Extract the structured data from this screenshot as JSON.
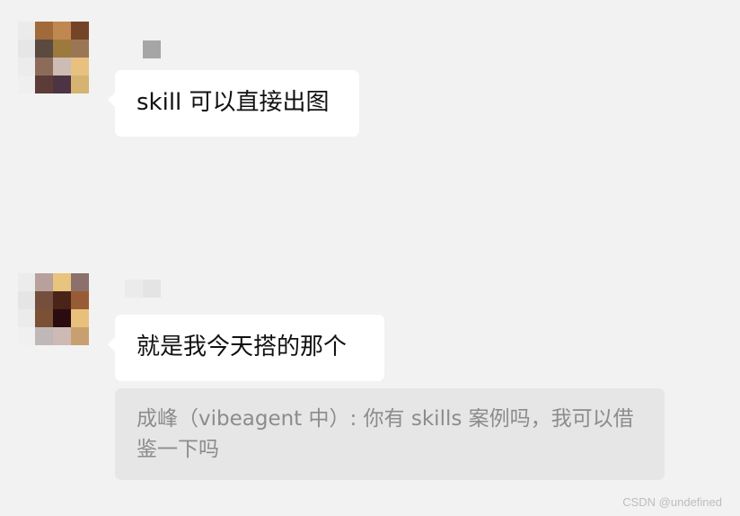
{
  "messages": [
    {
      "sender_avatar_colors": [
        [
          "#a06a3a",
          "#c08850",
          "#744428"
        ],
        [
          "#5a4a40",
          "#9c7a3c",
          "#9a7654"
        ],
        [
          "#8c6c58",
          "#cdbcb4",
          "#e8c080"
        ],
        [
          "#5c3c38",
          "#4c3444",
          "#d4b470"
        ]
      ],
      "sender_fringe_colors": [
        "#ebebeb",
        "#e6e6e6",
        "#ececec",
        "#efefef"
      ],
      "sender_name_colors": [
        "#a6a6a6"
      ],
      "text": "skill 可以直接出图"
    },
    {
      "sender_avatar_colors": [
        [
          "#b8a09c",
          "#e8c47c",
          "#8c706c"
        ],
        [
          "#74503c",
          "#4a2418",
          "#985c34"
        ],
        [
          "#7c5034",
          "#2a0c10",
          "#e8c07c"
        ],
        [
          "#c0b8b8",
          "#cdbab4",
          "#c8a070"
        ]
      ],
      "sender_fringe_colors": [
        "#ececec",
        "#e5e5e5",
        "#ebebeb",
        "#f0f0f0"
      ],
      "sender_name_colors": [
        "#ebebeb",
        "#e4e4e4"
      ],
      "text": "就是我今天搭的那个",
      "quote": "成峰（vibeagent 中）: 你有 skills 案例吗，我可以借鉴一下吗"
    }
  ],
  "watermark": "CSDN @undefined"
}
